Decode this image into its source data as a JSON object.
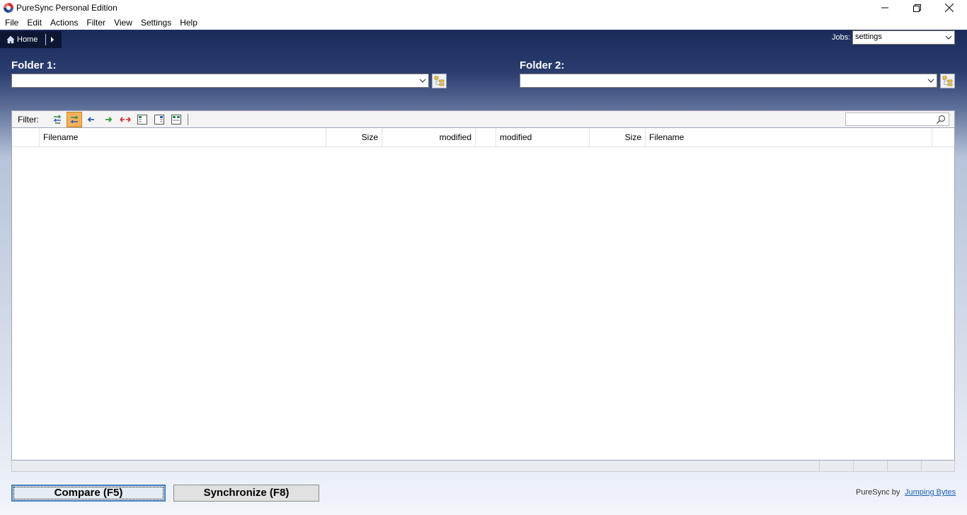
{
  "window": {
    "title": "PureSync Personal Edition"
  },
  "menu": [
    "File",
    "Edit",
    "Actions",
    "Filter",
    "View",
    "Settings",
    "Help"
  ],
  "breadcrumb": {
    "home_label": "Home"
  },
  "jobs": {
    "label": "Jobs:",
    "selected": "settings"
  },
  "folders": {
    "folder1_label": "Folder 1:",
    "folder1_value": "",
    "folder2_label": "Folder 2:",
    "folder2_value": ""
  },
  "filter": {
    "label": "Filter:",
    "search_value": ""
  },
  "columns": [
    "Filename",
    "Size",
    "modified",
    "modified",
    "Size",
    "Filename"
  ],
  "buttons": {
    "compare": "Compare (F5)",
    "synchronize": "Synchronize (F8)"
  },
  "footer": {
    "by_text": "PureSync by",
    "link_text": "Jumping Bytes"
  },
  "colors": {
    "header_dark": "#1b2b5a",
    "active_filter": "#f5b25a",
    "link": "#1a5fb4"
  }
}
